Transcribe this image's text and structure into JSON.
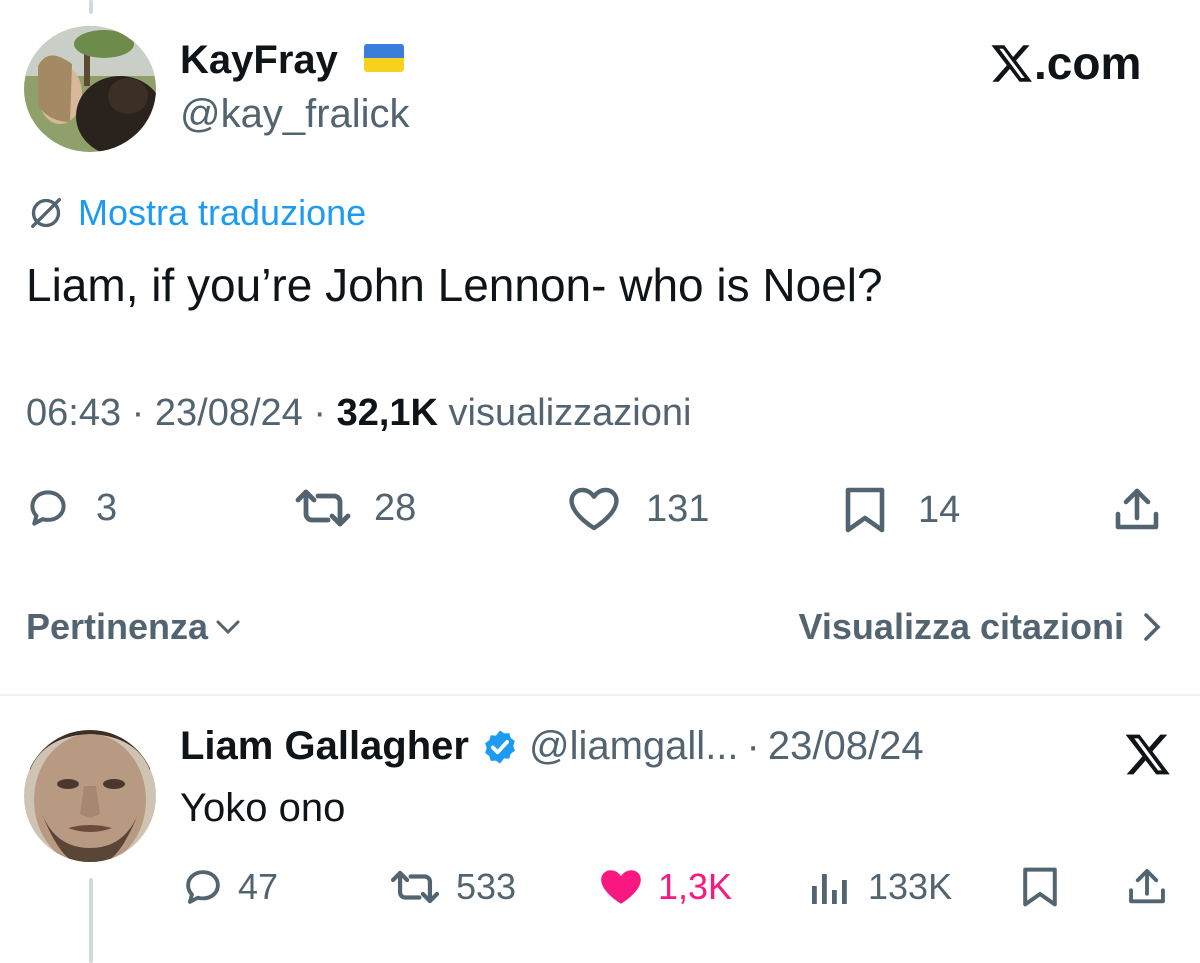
{
  "brand": {
    "label": ".com",
    "color": "#0f1419"
  },
  "tweet": {
    "author_name": "KayFray",
    "author_handle": "@kay_fralick",
    "translate_label": "Mostra traduzione",
    "text": "Liam, if you’re John Lennon- who is Noel?",
    "time": "06:43",
    "date": "23/08/24",
    "views_count": "32,1K",
    "views_label": "visualizzazioni",
    "stats": {
      "replies": "3",
      "retweets": "28",
      "likes": "131",
      "bookmarks": "14"
    }
  },
  "controls": {
    "sort_label": "Pertinenza",
    "quotes_label": "Visualizza citazioni"
  },
  "reply": {
    "author_name": "Liam Gallagher",
    "author_handle": "@liamgall...",
    "separator": "·",
    "date": "23/08/24",
    "text": "Yoko ono",
    "stats": {
      "replies": "47",
      "retweets": "533",
      "likes": "1,3K",
      "views": "133K"
    }
  },
  "colors": {
    "link": "#1d9bf0",
    "secondary": "#536471",
    "like": "#f91880",
    "verified": "#1d9bf0"
  }
}
